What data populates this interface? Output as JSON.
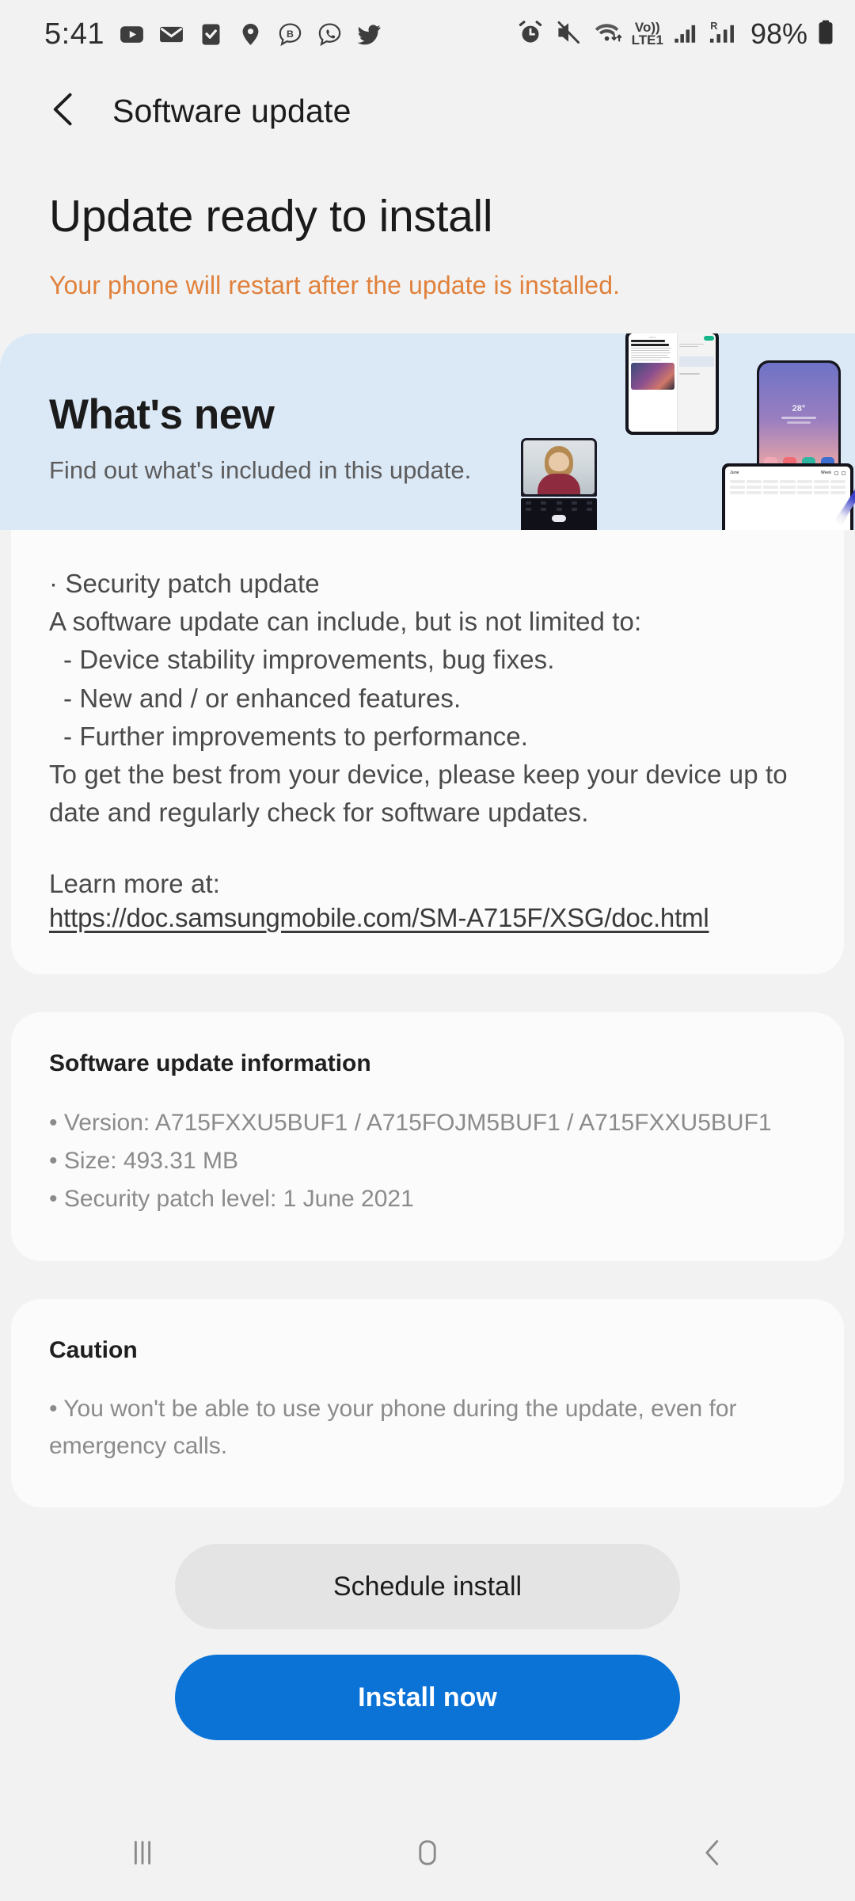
{
  "status_bar": {
    "time": "5:41",
    "left_icons": [
      "youtube-icon",
      "gmail-icon",
      "tasks-icon",
      "maps-pin-icon",
      "bkash-icon",
      "whatsapp-icon",
      "twitter-icon"
    ],
    "right_icons": [
      "alarm-icon",
      "mute-icon",
      "wifi-icon"
    ],
    "volte_top": "Vo))",
    "volte_bottom": "LTE1",
    "roaming_label": "R",
    "battery_percent": "98%"
  },
  "app_bar": {
    "back_icon": "chevron-left-icon",
    "title": "Software update"
  },
  "page": {
    "title": "Update ready to install",
    "warning": "Your phone will restart after the update is installed."
  },
  "banner": {
    "title": "What's new",
    "subtitle": "Find out what's included in this update.",
    "art_alt": "samsung-devices-collage",
    "background_color": "#dbe8f6",
    "device_headline_1": "Focus on",
    "device_headline_2": "what matters",
    "device_brand": "One UI"
  },
  "changelog": {
    "lines": [
      "· Security patch update",
      "A software update can include, but is not limited to:"
    ],
    "bullets": [
      "- Device stability improvements, bug fixes.",
      "- New and / or enhanced features.",
      "- Further improvements to performance."
    ],
    "closing": "To get the best from your device, please keep your device up to date and regularly check for software updates.",
    "learn_more_label": "Learn more at:",
    "learn_more_url": "https://doc.samsungmobile.com/SM-A715F/XSG/doc.html"
  },
  "update_info": {
    "heading": "Software update information",
    "items": [
      "• Version: A715FXXU5BUF1 / A715FOJM5BUF1 / A715FXXU5BUF1",
      "• Size: 493.31 MB",
      "• Security patch level: 1 June 2021"
    ]
  },
  "caution": {
    "heading": "Caution",
    "items": [
      "• You won't be able to use your phone during the update, even for emergency calls."
    ]
  },
  "actions": {
    "schedule_label": "Schedule install",
    "install_label": "Install now",
    "primary_color": "#0b72d6"
  },
  "nav_bar": {
    "recents_icon": "recents-icon",
    "home_icon": "home-icon",
    "back_icon": "nav-back-icon"
  }
}
